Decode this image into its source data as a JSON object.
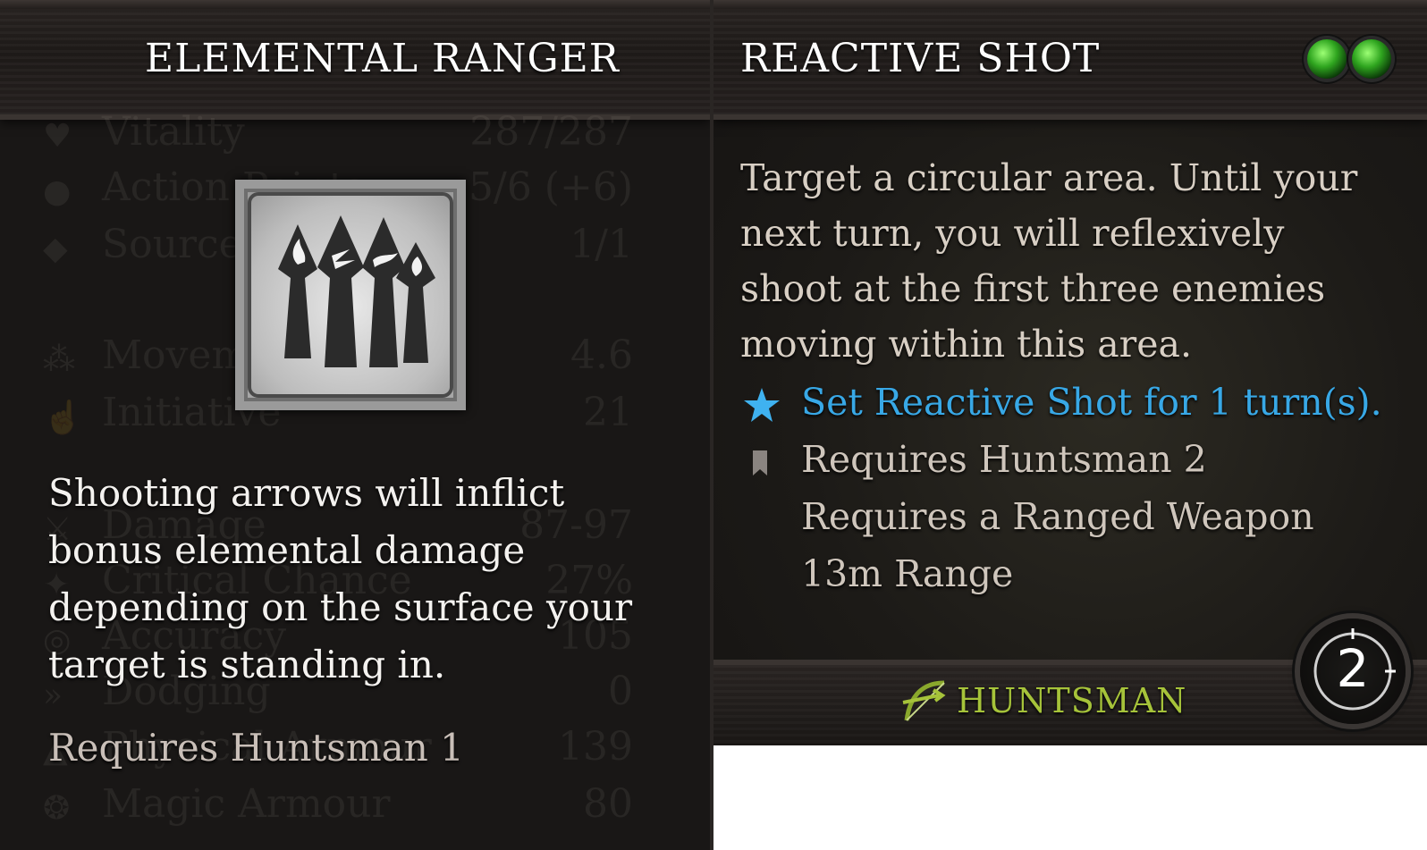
{
  "left_tooltip": {
    "title": "ELEMENTAL RANGER",
    "icon": "elemental-arrows-icon",
    "description": "Shooting arrows will inflict bonus elemental damage depending on the surface your target is standing in.",
    "requirement": "Requires Huntsman 1"
  },
  "background_stats": [
    {
      "label": "Vitality",
      "value": "287/287",
      "icon": "heart-icon"
    },
    {
      "label": "Action Points",
      "value": "5/6 (+6)",
      "icon": "circle-icon"
    },
    {
      "label": "Source",
      "value": "1/1",
      "icon": "diamond-icon"
    },
    {
      "label": "Movement",
      "value": "4.6",
      "icon": "boot-icon"
    },
    {
      "label": "Initiative",
      "value": "21",
      "icon": "hand-icon"
    },
    {
      "label": "Damage",
      "value": "87-97",
      "icon": "crossed-swords-icon"
    },
    {
      "label": "Critical Chance",
      "value": "27%",
      "icon": "critical-icon"
    },
    {
      "label": "Accuracy",
      "value": "105",
      "icon": "target-icon"
    },
    {
      "label": "Dodging",
      "value": "0",
      "icon": "running-icon"
    },
    {
      "label": "Physical Armour",
      "value": "139",
      "icon": "shield-icon"
    },
    {
      "label": "Magic Armour",
      "value": "80",
      "icon": "magic-shield-icon"
    }
  ],
  "right_tooltip": {
    "title": "REACTIVE SHOT",
    "action_points": 2,
    "ap_color": "#3fbf2a",
    "description": "Target a circular area. Until your next turn, you will reflexively shoot at the first three enemies moving within this area.",
    "effect": "Set Reactive Shot for 1 turn(s).",
    "effect_color": "#38a8e6",
    "requirement_ability": "Requires Huntsman 2",
    "requirement_weapon": "Requires a Ranged Weapon",
    "range": "13m Range",
    "school": "HUNTSMAN",
    "school_color": "#a6c33a",
    "cooldown": "2"
  }
}
